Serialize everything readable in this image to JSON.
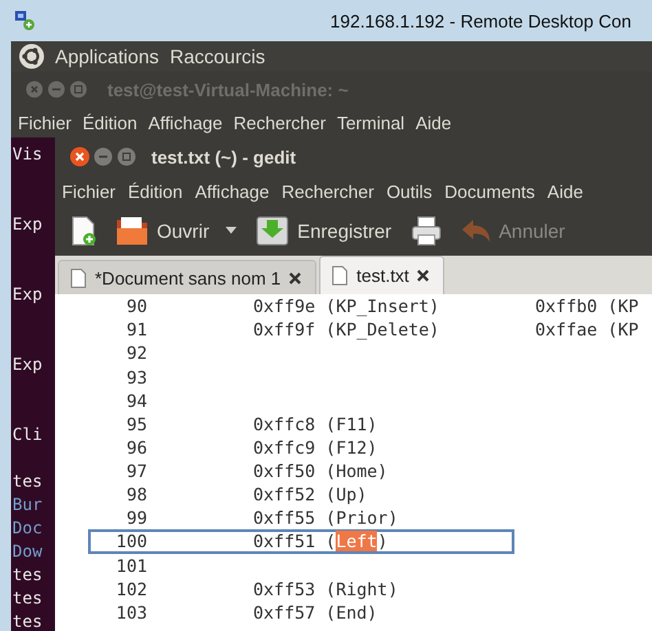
{
  "rdp_window": {
    "title": "192.168.1.192 - Remote Desktop Con"
  },
  "top_panel": {
    "menus": [
      "Applications",
      "Raccourcis"
    ]
  },
  "terminal": {
    "title": "test@test-Virtual-Machine: ~",
    "menus": [
      "Fichier",
      "Édition",
      "Affichage",
      "Rechercher",
      "Terminal",
      "Aide"
    ],
    "lines": [
      {
        "text": "Vis",
        "kind": "text"
      },
      {
        "text": "Exp",
        "kind": "text"
      },
      {
        "text": "Exp",
        "kind": "text"
      },
      {
        "text": "Exp",
        "kind": "text"
      },
      {
        "text": "Cli",
        "kind": "text"
      },
      {
        "text": "tes",
        "kind": "text"
      },
      {
        "text": "Bur",
        "kind": "directory"
      },
      {
        "text": "Doc",
        "kind": "directory"
      },
      {
        "text": "Dow",
        "kind": "directory"
      },
      {
        "text": "tes",
        "kind": "text"
      },
      {
        "text": "tes",
        "kind": "text"
      },
      {
        "text": "tes",
        "kind": "text"
      }
    ]
  },
  "gedit": {
    "title": "test.txt (~) - gedit",
    "menus": [
      "Fichier",
      "Édition",
      "Affichage",
      "Rechercher",
      "Outils",
      "Documents",
      "Aide"
    ],
    "toolbar": [
      {
        "kind": "new",
        "disabled": false
      },
      {
        "kind": "open",
        "label": "Ouvrir",
        "disabled": false
      },
      {
        "kind": "save",
        "label": "Enregistrer",
        "disabled": false
      },
      {
        "kind": "print",
        "disabled": false
      },
      {
        "kind": "undo",
        "label": "Annuler",
        "disabled": true
      }
    ],
    "tabs": [
      {
        "label": "*Document sans nom 1",
        "selected": false
      },
      {
        "label": "test.txt",
        "selected": true
      }
    ],
    "lines": [
      {
        "number": "90",
        "column_2": "0xff9e (KP_Insert)",
        "column_3": "0xffb0 (KP"
      },
      {
        "number": "91",
        "column_2": "0xff9f (KP_Delete)",
        "column_3": "0xffae (KP"
      },
      {
        "number": "92"
      },
      {
        "number": "93"
      },
      {
        "number": "94"
      },
      {
        "number": "95",
        "column_2": "0xffc8 (F11)"
      },
      {
        "number": "96",
        "column_2": "0xffc9 (F12)"
      },
      {
        "number": "97",
        "column_2": "0xff50 (Home)"
      },
      {
        "number": "98",
        "column_2": "0xff52 (Up)"
      },
      {
        "number": "99",
        "column_2": "0xff55 (Prior)"
      },
      {
        "number": "100",
        "column_2": "0xff51 (",
        "selection": "Left",
        "after_selection": ")",
        "current": true
      },
      {
        "number": "101"
      },
      {
        "number": "102",
        "column_2": "0xff53 (Right)"
      },
      {
        "number": "103",
        "column_2": "0xff57 (End)"
      }
    ]
  }
}
